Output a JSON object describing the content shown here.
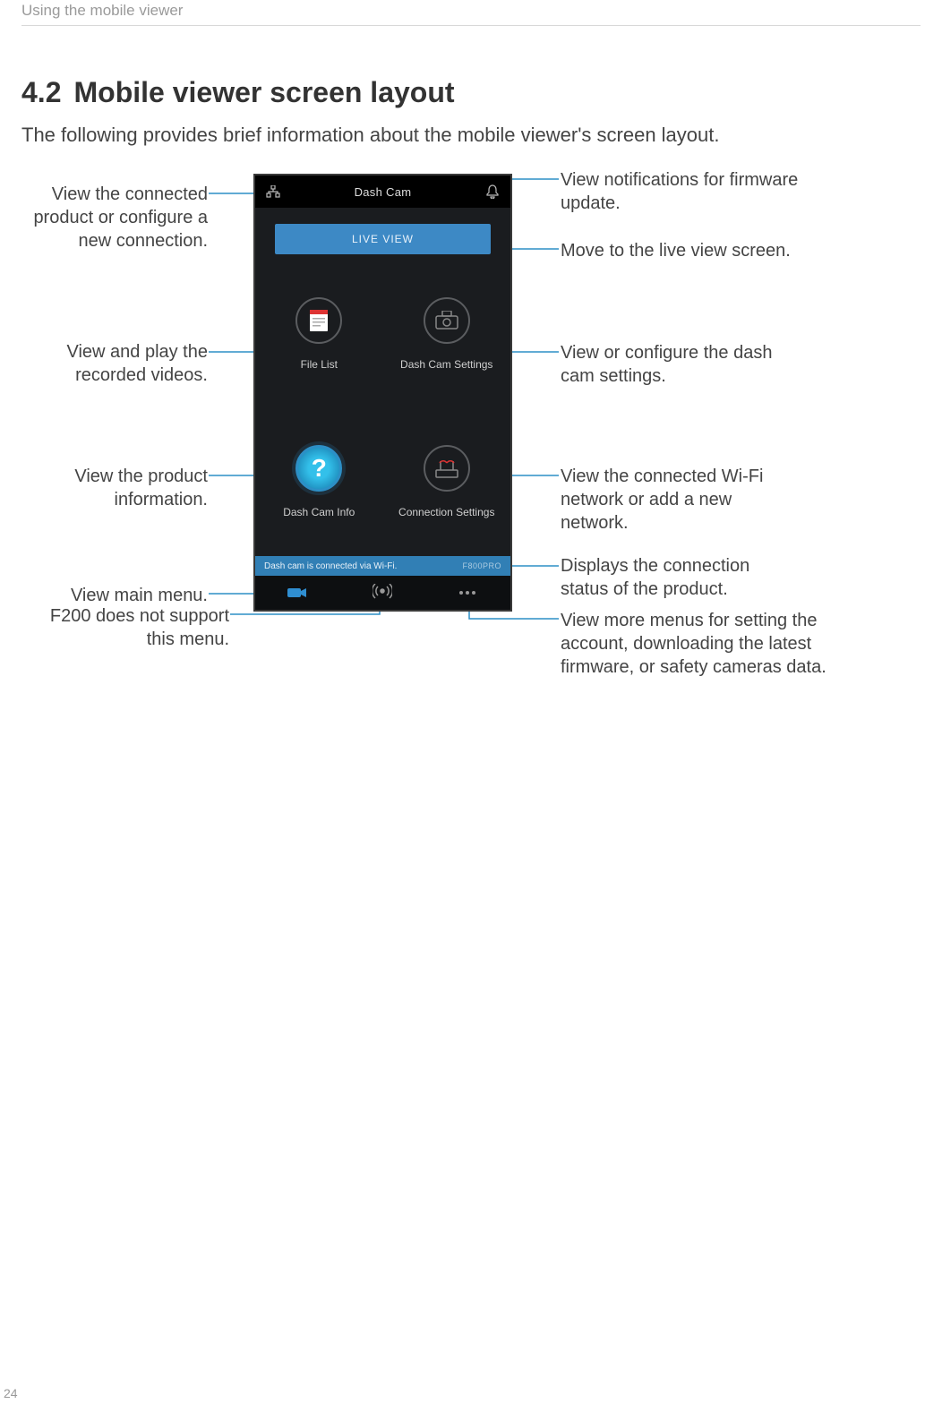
{
  "chapter_header": "Using the mobile viewer",
  "section": {
    "num": "4.2",
    "title": "Mobile viewer screen layout"
  },
  "intro": "The following provides brief information about the mobile viewer's screen layout.",
  "phone": {
    "header_title": "Dash Cam",
    "live_view_btn": "LIVE VIEW",
    "tiles": {
      "file_list": "File List",
      "settings": "Dash Cam Settings",
      "info": "Dash Cam Info",
      "conn": "Connection Settings"
    },
    "status_msg": "Dash cam is connected via Wi-Fi.",
    "status_device": "F800PRO"
  },
  "callouts": {
    "conn_left": "View the connected product or configure a new connection.",
    "videos_left": "View and play the recorded videos.",
    "info_left": "View the product information.",
    "mainmenu_left": "View main menu.",
    "f200_left": "F200 does not support this menu.",
    "notif_right": "View notifications for firmware update.",
    "live_right": "Move to the live view screen.",
    "settings_right": "View or configure the dash cam settings.",
    "wifi_right": "View the connected Wi-Fi network or add a new network.",
    "status_right": "Displays the connection status of the product.",
    "more_right": "View more menus for setting the account, downloading the latest firmware, or safety cameras data."
  },
  "page_number": "24"
}
